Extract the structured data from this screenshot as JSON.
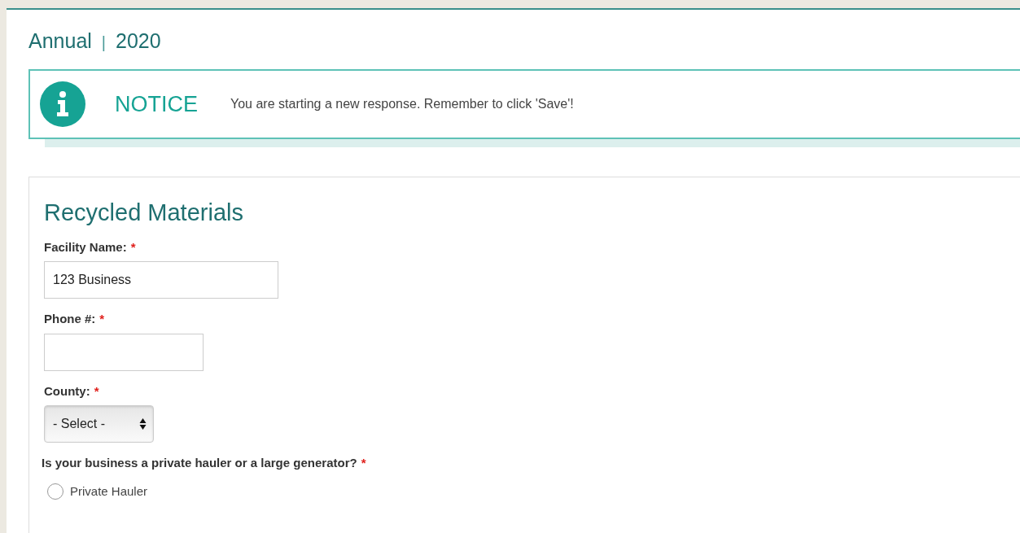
{
  "header": {
    "period": "Annual",
    "separator": "|",
    "year": "2020"
  },
  "notice": {
    "title": "NOTICE",
    "message": "You are starting a new response. Remember to click 'Save'!"
  },
  "form": {
    "title": "Recycled Materials",
    "fields": [
      {
        "kind": "text",
        "label": "Facility Name:",
        "required_mark": "*",
        "value": "123 Business"
      },
      {
        "kind": "text",
        "label": "Phone #:",
        "required_mark": "*"
      },
      {
        "kind": "select",
        "label": "County:",
        "required_mark": "*",
        "value": "- Select -"
      },
      {
        "kind": "radio",
        "label": "Is your business a private hauler or a large generator?",
        "required_mark": "*",
        "options": [
          {
            "label": "Private Hauler",
            "selected": false
          }
        ]
      }
    ]
  }
}
